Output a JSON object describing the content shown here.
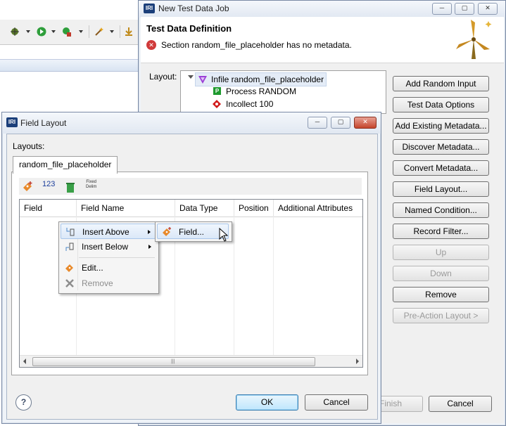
{
  "test_data_job": {
    "window_title": "New Test Data Job",
    "heading": "Test Data Definition",
    "error_message": "Section random_file_placeholder has no metadata.",
    "layout_label": "Layout:",
    "tree": [
      {
        "label": "Infile random_file_placeholder",
        "icon": "infile-icon",
        "color": "#9b3fd6"
      },
      {
        "label": "Process RANDOM",
        "icon": "process-icon",
        "color": "#1e9a2e"
      },
      {
        "label": "Incollect 100",
        "icon": "incollect-icon",
        "color": "#d11b1b"
      }
    ],
    "buttons": [
      {
        "label": "Add Random Input",
        "enabled": true
      },
      {
        "label": "Test Data Options",
        "enabled": true
      },
      {
        "label": "Add Existing Metadata...",
        "enabled": true
      },
      {
        "label": "Discover Metadata...",
        "enabled": true
      },
      {
        "label": "Convert Metadata...",
        "enabled": true
      },
      {
        "label": "Field Layout...",
        "enabled": true
      },
      {
        "label": "Named Condition...",
        "enabled": true
      },
      {
        "label": "Record Filter...",
        "enabled": true
      },
      {
        "label": "Up",
        "enabled": false
      },
      {
        "label": "Down",
        "enabled": false
      },
      {
        "label": "Remove",
        "enabled": true
      },
      {
        "label": "Pre-Action Layout >",
        "enabled": false
      }
    ],
    "finish_label": "Finish",
    "cancel_label": "Cancel"
  },
  "field_layout": {
    "window_title": "Field Layout",
    "layouts_label": "Layouts:",
    "tab_label": "random_file_placeholder",
    "toolbar": {
      "add_icon": "add-field-icon",
      "number_label": "123",
      "delete_icon": "trash-icon",
      "fixed_delim_label_1": "Fixed",
      "fixed_delim_label_2": "Delim"
    },
    "columns": [
      "Field",
      "Field Name",
      "Data Type",
      "Position",
      "Additional Attributes"
    ],
    "ok_label": "OK",
    "cancel_label": "Cancel",
    "help_label": "?"
  },
  "context_menu": {
    "items": [
      {
        "label": "Insert Above",
        "enabled": true,
        "submenu": true
      },
      {
        "label": "Insert Below",
        "enabled": true,
        "submenu": true
      },
      {
        "label": "Edit...",
        "enabled": true,
        "submenu": false
      },
      {
        "label": "Remove",
        "enabled": false,
        "submenu": false
      }
    ],
    "submenu_items": [
      {
        "label": "Field..."
      }
    ]
  },
  "logo_text": "IRI"
}
